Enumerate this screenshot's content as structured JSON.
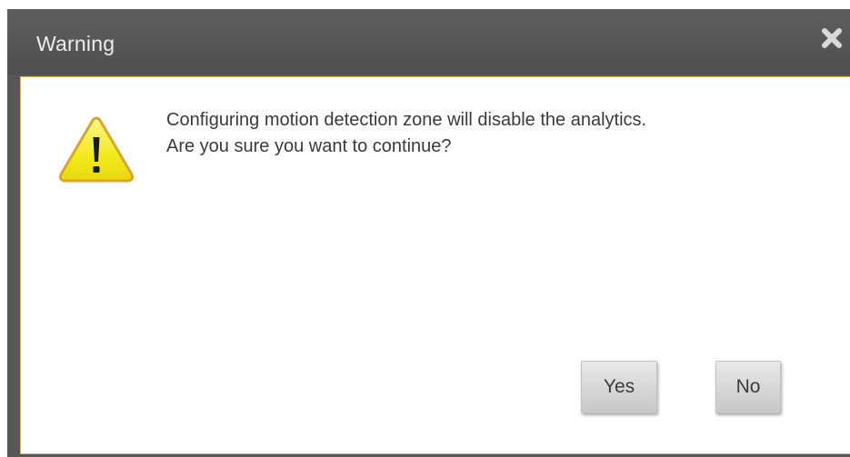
{
  "dialog": {
    "title": "Warning",
    "close_icon": "close-icon",
    "warning_icon": "warning-triangle-icon",
    "message_lines": [
      "Configuring motion detection zone will disable the analytics.",
      "Are you sure you want to continue?"
    ],
    "buttons": {
      "yes_label": "Yes",
      "no_label": "No"
    }
  },
  "colors": {
    "titlebar": "#575757",
    "title_text": "#ececec",
    "body_border": "#e7b06a",
    "warning_fill": "#f5ee2a",
    "warning_stroke": "#d9a52c"
  }
}
